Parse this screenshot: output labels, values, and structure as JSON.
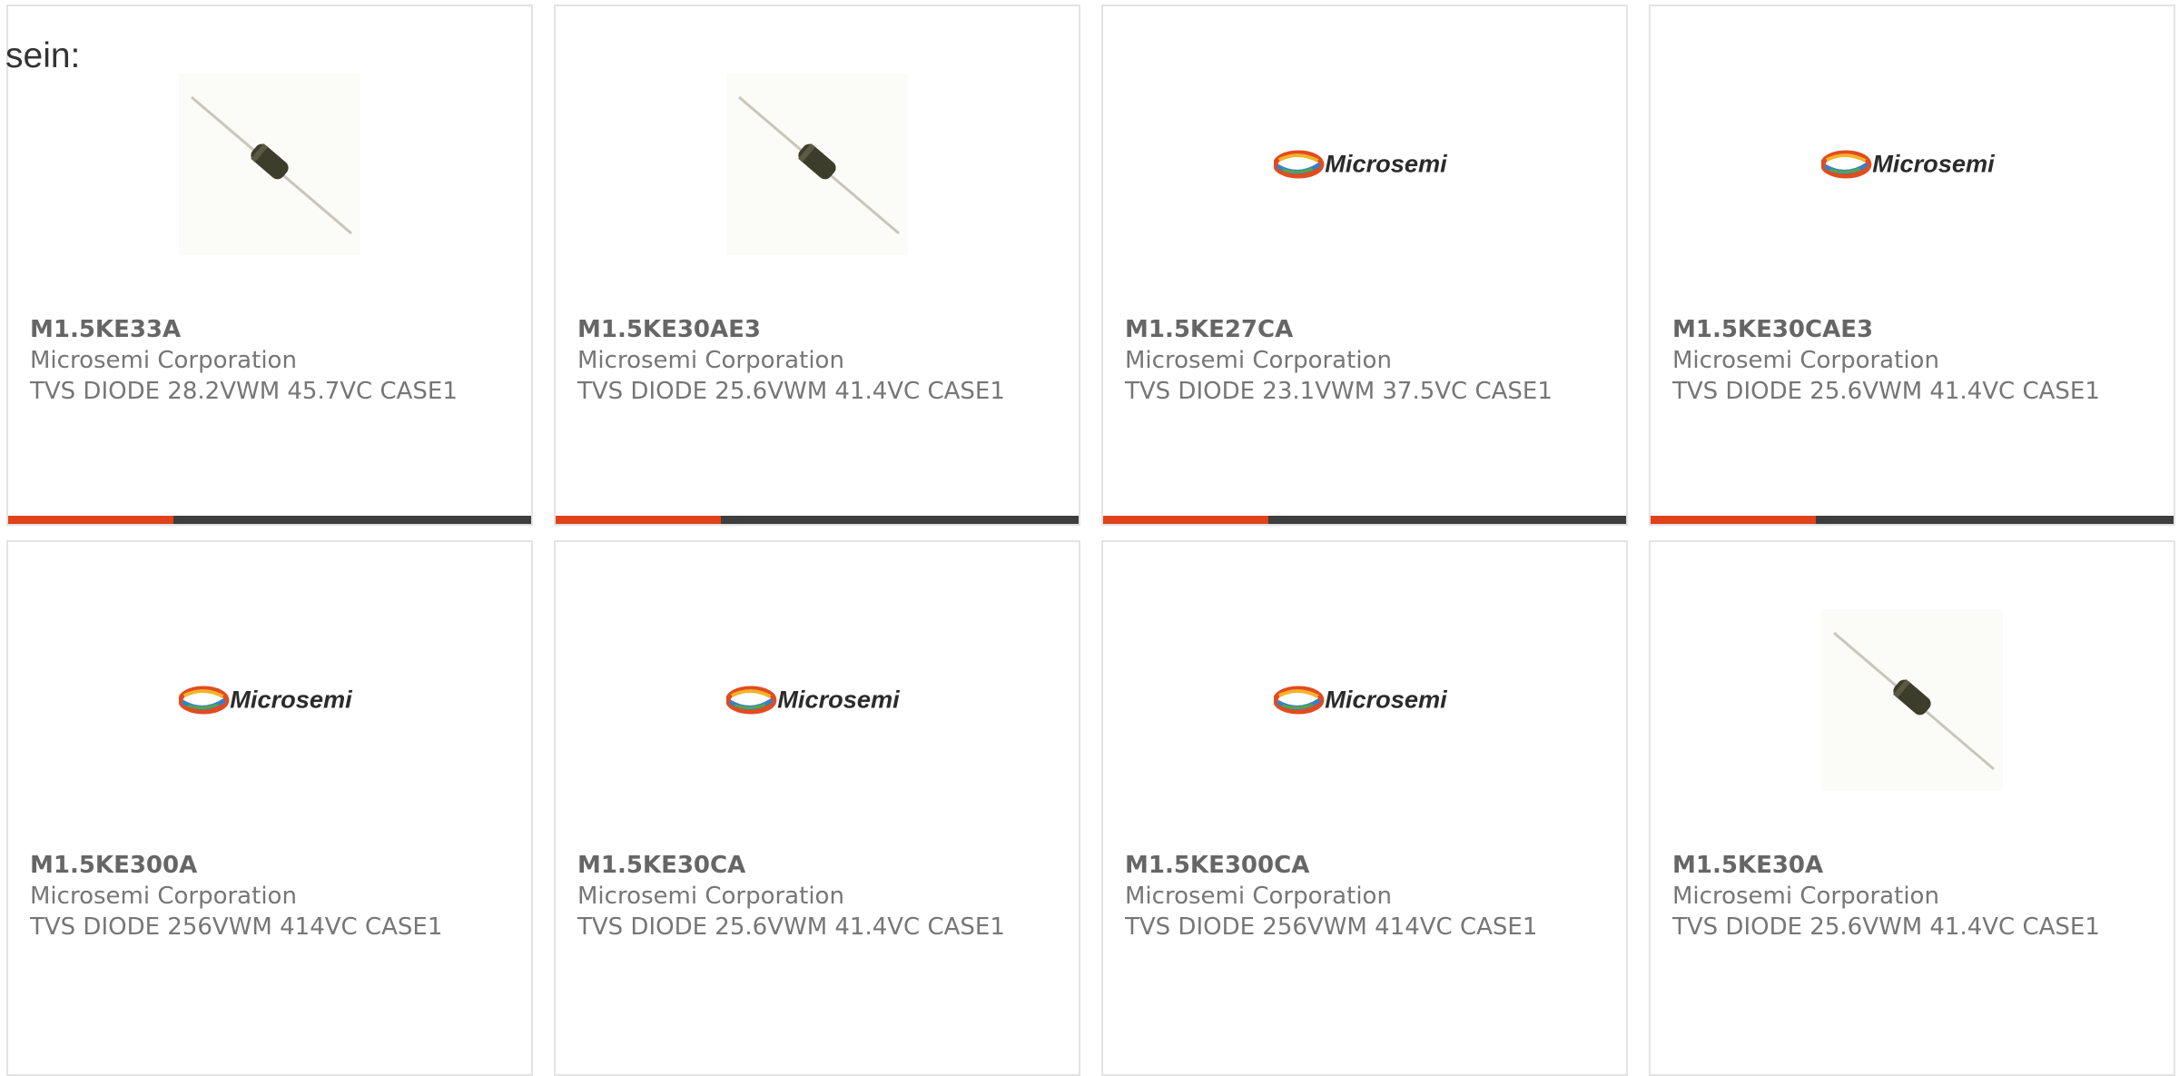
{
  "intro_text": "sein:",
  "accent_color": "#e0421c",
  "bar_color": "#3e3e3e",
  "products": [
    {
      "part": "M1.5KE33A",
      "maker": "Microsemi Corporation",
      "desc": "TVS DIODE 28.2VWM 45.7VC CASE1",
      "image": "diode-photo"
    },
    {
      "part": "M1.5KE30AE3",
      "maker": "Microsemi Corporation",
      "desc": "TVS DIODE 25.6VWM 41.4VC CASE1",
      "image": "diode-photo"
    },
    {
      "part": "M1.5KE27CA",
      "maker": "Microsemi Corporation",
      "desc": "TVS DIODE 23.1VWM 37.5VC CASE1",
      "image": "microsemi-logo",
      "logo_text": "Microsemi"
    },
    {
      "part": "M1.5KE30CAE3",
      "maker": "Microsemi Corporation",
      "desc": "TVS DIODE 25.6VWM 41.4VC CASE1",
      "image": "microsemi-logo",
      "logo_text": "Microsemi"
    },
    {
      "part": "M1.5KE300A",
      "maker": "Microsemi Corporation",
      "desc": "TVS DIODE 256VWM 414VC CASE1",
      "image": "microsemi-logo",
      "logo_text": "Microsemi"
    },
    {
      "part": "M1.5KE30CA",
      "maker": "Microsemi Corporation",
      "desc": "TVS DIODE 25.6VWM 41.4VC CASE1",
      "image": "microsemi-logo",
      "logo_text": "Microsemi"
    },
    {
      "part": "M1.5KE300CA",
      "maker": "Microsemi Corporation",
      "desc": "TVS DIODE 256VWM 414VC CASE1",
      "image": "microsemi-logo",
      "logo_text": "Microsemi"
    },
    {
      "part": "M1.5KE30A",
      "maker": "Microsemi Corporation",
      "desc": "TVS DIODE 25.6VWM 41.4VC CASE1",
      "image": "diode-photo"
    }
  ]
}
